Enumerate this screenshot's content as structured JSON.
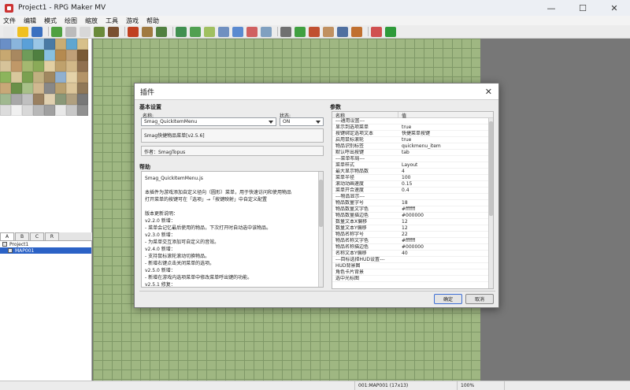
{
  "window": {
    "title": "Project1 - RPG Maker MV",
    "controls": [
      "—",
      "☐",
      "✕"
    ]
  },
  "menu": [
    "文件",
    "编辑",
    "模式",
    "绘图",
    "缩放",
    "工具",
    "游戏",
    "帮助"
  ],
  "toolbar_colors": [
    "#e8e8e8",
    "#f0c020",
    "#3a70c0",
    "#4fa040",
    "#bbbbbb",
    "#d8d8d8",
    "#6a8a3a",
    "#7a5030",
    "#c04020",
    "#a07a40",
    "#508040",
    "#409050",
    "#50a050",
    "#a0c060",
    "#7090c0",
    "#5a8ad0",
    "#d06060",
    "#80a0c0",
    "#707070",
    "#40a040",
    "#c05030",
    "#c09060",
    "#5070a0",
    "#c07030",
    "#d05050",
    "#2e9a3a"
  ],
  "tile_colors": [
    "#6a8fc7",
    "#8ab5dc",
    "#5aa0d8",
    "#9ac6e6",
    "#4a7aa4",
    "#c9ad74",
    "#5fa6d0",
    "#d7c08a",
    "#c7a871",
    "#a88860",
    "#6f9c5a",
    "#4f7f40",
    "#88c0e0",
    "#b58a50",
    "#c0a078",
    "#7a5a35",
    "#d6c39a",
    "#c09868",
    "#a4b870",
    "#8aaa58",
    "#e2cfa2",
    "#bfa16c",
    "#d2b888",
    "#907050",
    "#8cb45c",
    "#d8c89c",
    "#7aa050",
    "#c0b080",
    "#a08860",
    "#90b0d0",
    "#e4d2a8",
    "#b49468",
    "#c8a878",
    "#6a9048",
    "#a8c088",
    "#d0b890",
    "#888888",
    "#b8a070",
    "#dcc69a",
    "#907858",
    "#a0b890",
    "#a8a8a8",
    "#c0c0c0",
    "#9a8060",
    "#e0d0b0",
    "#8a9878",
    "#b0a080",
    "#787878",
    "#dcdcdc",
    "#f0f0f0",
    "#d8d8d8",
    "#b8b8b8",
    "#a0a0a0",
    "#e8e8e8",
    "#c8c8c8",
    "#909090"
  ],
  "tabs": [
    "A",
    "B",
    "C",
    "R"
  ],
  "map_tree": {
    "root": "Project1",
    "selected": "MAP001"
  },
  "status": {
    "map": "001:MAP001 (17x13)",
    "zoom": "100%"
  },
  "dialog": {
    "title": "插件",
    "close": "✕",
    "basic_settings": "基本设置",
    "name_label": "名称:",
    "name_value": "Smag_QuickItemMenu",
    "status_label": "状态:",
    "status_value": "ON",
    "description": "Smag快捷物品菜单[v2.5.6]",
    "author": "作者：SmagTopus",
    "help_label": "帮助",
    "help_lines": [
      "Smag_QuickItemMenu.js",
      "",
      "本插件为游戏添加自定义径向（圆形）菜单，用于快速访问和使用物品",
      "打开菜单的按键可在「选项」→「按键映射」中自定义配置",
      "",
      "版本更新说明：",
      "v2.2.0 新增：",
      "- 菜单会记忆最后使用的物品，下次打开时自动选中该物品。",
      "v2.3.0 新增：",
      "- 为菜单交互添加可自定义的音效。",
      "v2.4.0 新增：",
      "- 支持鼠标滚轮滚动切换物品。",
      "- 新增右键点击关闭菜单的选项。",
      "v2.5.0 新增：",
      "- 新增在游戏内选项菜单中修改菜单呼出键的功能。",
      "v2.5.1 修复：",
      "- 修复将菜单键绑定到字母键时失效的BUG。"
    ],
    "params_label": "参数",
    "params_header": [
      "名称",
      "值"
    ],
    "params": [
      [
        "---通用设置---",
        ""
      ],
      [
        "显示到选项菜单",
        "true"
      ],
      [
        "按键绑定选项文本",
        "快捷菜单按键"
      ],
      [
        "启用鼠标滚轮",
        "true"
      ],
      [
        "物品识别标签",
        "quickmenu_item"
      ],
      [
        "默认呼出按键",
        "tab"
      ],
      [
        "---菜单布局---",
        ""
      ],
      [
        "菜单样式",
        "Layout"
      ],
      [
        "最大显示物品数",
        "4"
      ],
      [
        "菜单半径",
        "100"
      ],
      [
        "滚动动画速度",
        "0.15"
      ],
      [
        "菜单开合速度",
        "0.4"
      ],
      [
        "---物品显示---",
        ""
      ],
      [
        "物品数量字号",
        "18"
      ],
      [
        "物品数量文字色",
        "#ffffff"
      ],
      [
        "物品数量描边色",
        "#000000"
      ],
      [
        "数量文本X偏移",
        "12"
      ],
      [
        "数量文本Y偏移",
        "12"
      ],
      [
        "物品名称字号",
        "22"
      ],
      [
        "物品名称文字色",
        "#ffffff"
      ],
      [
        "物品名称描边色",
        "#000000"
      ],
      [
        "名称文本Y偏移",
        "40"
      ],
      [
        "---目标选择HUD设置---",
        ""
      ],
      [
        "HUD背景图",
        ""
      ],
      [
        "角色卡片背景",
        ""
      ],
      [
        "选中光标图",
        ""
      ]
    ],
    "ok": "确定",
    "cancel": "取消"
  }
}
